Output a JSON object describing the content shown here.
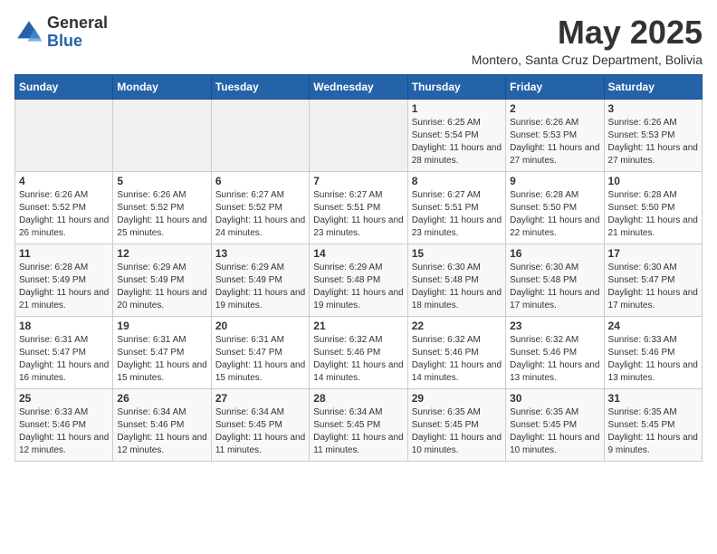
{
  "header": {
    "logo_general": "General",
    "logo_blue": "Blue",
    "month_title": "May 2025",
    "location": "Montero, Santa Cruz Department, Bolivia"
  },
  "days_of_week": [
    "Sunday",
    "Monday",
    "Tuesday",
    "Wednesday",
    "Thursday",
    "Friday",
    "Saturday"
  ],
  "weeks": [
    [
      {
        "day": "",
        "info": ""
      },
      {
        "day": "",
        "info": ""
      },
      {
        "day": "",
        "info": ""
      },
      {
        "day": "",
        "info": ""
      },
      {
        "day": "1",
        "info": "Sunrise: 6:25 AM\nSunset: 5:54 PM\nDaylight: 11 hours and 28 minutes."
      },
      {
        "day": "2",
        "info": "Sunrise: 6:26 AM\nSunset: 5:53 PM\nDaylight: 11 hours and 27 minutes."
      },
      {
        "day": "3",
        "info": "Sunrise: 6:26 AM\nSunset: 5:53 PM\nDaylight: 11 hours and 27 minutes."
      }
    ],
    [
      {
        "day": "4",
        "info": "Sunrise: 6:26 AM\nSunset: 5:52 PM\nDaylight: 11 hours and 26 minutes."
      },
      {
        "day": "5",
        "info": "Sunrise: 6:26 AM\nSunset: 5:52 PM\nDaylight: 11 hours and 25 minutes."
      },
      {
        "day": "6",
        "info": "Sunrise: 6:27 AM\nSunset: 5:52 PM\nDaylight: 11 hours and 24 minutes."
      },
      {
        "day": "7",
        "info": "Sunrise: 6:27 AM\nSunset: 5:51 PM\nDaylight: 11 hours and 23 minutes."
      },
      {
        "day": "8",
        "info": "Sunrise: 6:27 AM\nSunset: 5:51 PM\nDaylight: 11 hours and 23 minutes."
      },
      {
        "day": "9",
        "info": "Sunrise: 6:28 AM\nSunset: 5:50 PM\nDaylight: 11 hours and 22 minutes."
      },
      {
        "day": "10",
        "info": "Sunrise: 6:28 AM\nSunset: 5:50 PM\nDaylight: 11 hours and 21 minutes."
      }
    ],
    [
      {
        "day": "11",
        "info": "Sunrise: 6:28 AM\nSunset: 5:49 PM\nDaylight: 11 hours and 21 minutes."
      },
      {
        "day": "12",
        "info": "Sunrise: 6:29 AM\nSunset: 5:49 PM\nDaylight: 11 hours and 20 minutes."
      },
      {
        "day": "13",
        "info": "Sunrise: 6:29 AM\nSunset: 5:49 PM\nDaylight: 11 hours and 19 minutes."
      },
      {
        "day": "14",
        "info": "Sunrise: 6:29 AM\nSunset: 5:48 PM\nDaylight: 11 hours and 19 minutes."
      },
      {
        "day": "15",
        "info": "Sunrise: 6:30 AM\nSunset: 5:48 PM\nDaylight: 11 hours and 18 minutes."
      },
      {
        "day": "16",
        "info": "Sunrise: 6:30 AM\nSunset: 5:48 PM\nDaylight: 11 hours and 17 minutes."
      },
      {
        "day": "17",
        "info": "Sunrise: 6:30 AM\nSunset: 5:47 PM\nDaylight: 11 hours and 17 minutes."
      }
    ],
    [
      {
        "day": "18",
        "info": "Sunrise: 6:31 AM\nSunset: 5:47 PM\nDaylight: 11 hours and 16 minutes."
      },
      {
        "day": "19",
        "info": "Sunrise: 6:31 AM\nSunset: 5:47 PM\nDaylight: 11 hours and 15 minutes."
      },
      {
        "day": "20",
        "info": "Sunrise: 6:31 AM\nSunset: 5:47 PM\nDaylight: 11 hours and 15 minutes."
      },
      {
        "day": "21",
        "info": "Sunrise: 6:32 AM\nSunset: 5:46 PM\nDaylight: 11 hours and 14 minutes."
      },
      {
        "day": "22",
        "info": "Sunrise: 6:32 AM\nSunset: 5:46 PM\nDaylight: 11 hours and 14 minutes."
      },
      {
        "day": "23",
        "info": "Sunrise: 6:32 AM\nSunset: 5:46 PM\nDaylight: 11 hours and 13 minutes."
      },
      {
        "day": "24",
        "info": "Sunrise: 6:33 AM\nSunset: 5:46 PM\nDaylight: 11 hours and 13 minutes."
      }
    ],
    [
      {
        "day": "25",
        "info": "Sunrise: 6:33 AM\nSunset: 5:46 PM\nDaylight: 11 hours and 12 minutes."
      },
      {
        "day": "26",
        "info": "Sunrise: 6:34 AM\nSunset: 5:46 PM\nDaylight: 11 hours and 12 minutes."
      },
      {
        "day": "27",
        "info": "Sunrise: 6:34 AM\nSunset: 5:45 PM\nDaylight: 11 hours and 11 minutes."
      },
      {
        "day": "28",
        "info": "Sunrise: 6:34 AM\nSunset: 5:45 PM\nDaylight: 11 hours and 11 minutes."
      },
      {
        "day": "29",
        "info": "Sunrise: 6:35 AM\nSunset: 5:45 PM\nDaylight: 11 hours and 10 minutes."
      },
      {
        "day": "30",
        "info": "Sunrise: 6:35 AM\nSunset: 5:45 PM\nDaylight: 11 hours and 10 minutes."
      },
      {
        "day": "31",
        "info": "Sunrise: 6:35 AM\nSunset: 5:45 PM\nDaylight: 11 hours and 9 minutes."
      }
    ]
  ]
}
